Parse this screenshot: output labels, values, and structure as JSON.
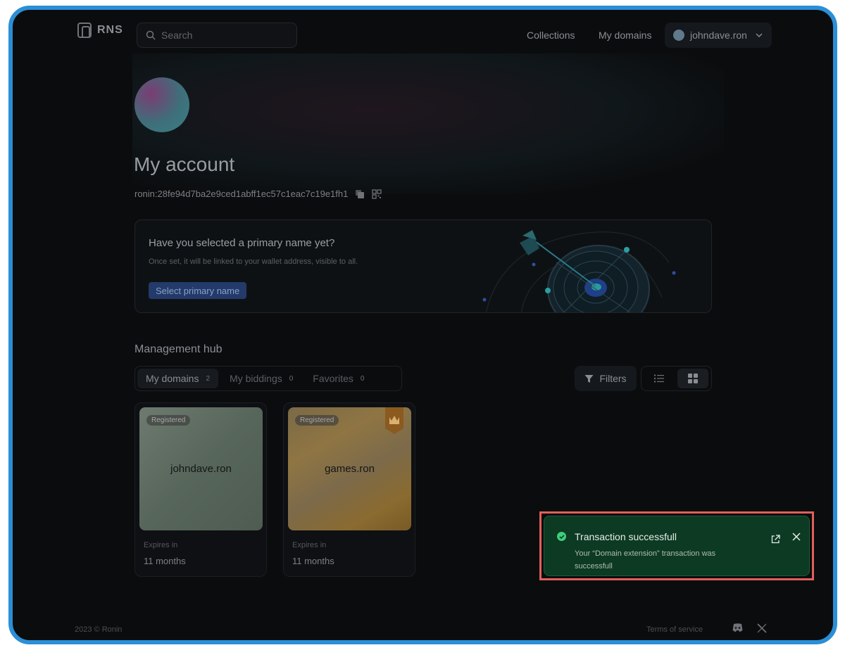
{
  "brand": {
    "name": "RNS"
  },
  "search": {
    "placeholder": "Search"
  },
  "nav": {
    "collections": "Collections",
    "my_domains": "My domains",
    "account": "johndave.ron"
  },
  "profile": {
    "title": "My account",
    "address": "ronin:28fe94d7ba2e9ced1abff1ec57c1eac7c19e1fh1"
  },
  "primary_name": {
    "title": "Have you selected a primary name yet?",
    "description": "Once set, it will be linked to your wallet address, visible to all.",
    "button": "Select primary name"
  },
  "hub": {
    "title": "Management hub",
    "tabs": [
      {
        "label": "My domains",
        "count": "2"
      },
      {
        "label": "My biddings",
        "count": "0"
      },
      {
        "label": "Favorites",
        "count": "0"
      }
    ],
    "filters": "Filters"
  },
  "domains": [
    {
      "name": "johndave.ron",
      "status": "Registered",
      "expires_label": "Expires in",
      "expires_value": "11 months"
    },
    {
      "name": "games.ron",
      "status": "Registered",
      "expires_label": "Expires in",
      "expires_value": "11 months"
    }
  ],
  "toast": {
    "title": "Transaction successfull",
    "message": "Your “Domain extension” transaction was successfull"
  },
  "footer": {
    "copyright": "2023 © Ronin",
    "terms": "Terms of service"
  },
  "colors": {
    "frame_border": "#2b8fd6",
    "toast_bg": "#0c3a22",
    "toast_check": "#3dcf7a",
    "highlight": "#e0615a",
    "primary_button": "#233a6a"
  },
  "icons": [
    "search-icon",
    "chevron-down-icon",
    "copy-icon",
    "qr-code-icon",
    "filter-icon",
    "list-view-icon",
    "grid-view-icon",
    "crown-icon",
    "check-circle-icon",
    "external-link-icon",
    "close-icon",
    "discord-icon",
    "x-logo-icon"
  ]
}
